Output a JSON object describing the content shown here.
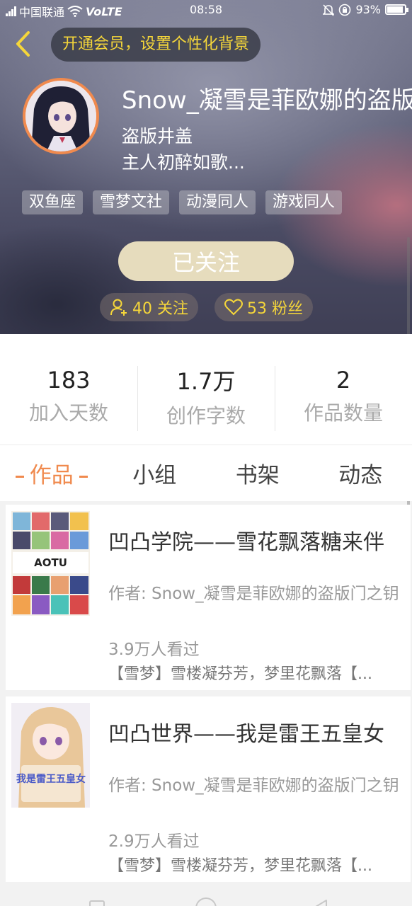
{
  "status_bar": {
    "carrier": "中国联通",
    "network": "VoLTE",
    "time": "08:58",
    "battery": "93%",
    "battery_level": 0.93
  },
  "header": {
    "vip_banner": "开通会员，设置个性化背景"
  },
  "profile": {
    "username": "Snow_凝雪是菲欧娜的盗版门之钥",
    "bio_line1": "盗版井盖",
    "bio_line2": "主人初醉如歌...",
    "tags": [
      "双鱼座",
      "雪梦文社",
      "动漫同人",
      "游戏同人"
    ],
    "follow_state": "已关注",
    "following": "40 关注",
    "fans": "53 粉丝"
  },
  "stats": [
    {
      "value": "183",
      "label": "加入天数"
    },
    {
      "value": "1.7万",
      "label": "创作字数"
    },
    {
      "value": "2",
      "label": "作品数量"
    }
  ],
  "tabs": [
    {
      "label": "作品",
      "active": true
    },
    {
      "label": "小组",
      "active": false
    },
    {
      "label": "书架",
      "active": false
    },
    {
      "label": "动态",
      "active": false
    }
  ],
  "works": [
    {
      "title": "凹凸学院——雪花飘落糖来伴",
      "author": "作者: Snow_凝雪是菲欧娜的盗版门之钥",
      "views": "3.9万人看过",
      "desc": "【雪梦】雪楼凝芬芳，梦里花飘落【...",
      "cover_text": "AOTU"
    },
    {
      "title": "凹凸世界——我是雷王五皇女",
      "author": "作者: Snow_凝雪是菲欧娜的盗版门之钥",
      "views": "2.9万人看过",
      "desc": "【雪梦】雪楼凝芬芳，梦里花飘落【...",
      "cover_text": "我是雷王五皇女"
    }
  ],
  "colors": {
    "accent": "#f08a4e",
    "vip_text": "#f5d63a",
    "follow_button": "#e6dcbd"
  },
  "icons": {
    "back": "chevron-left-icon",
    "following": "person-plus-icon",
    "fans": "heart-icon"
  }
}
